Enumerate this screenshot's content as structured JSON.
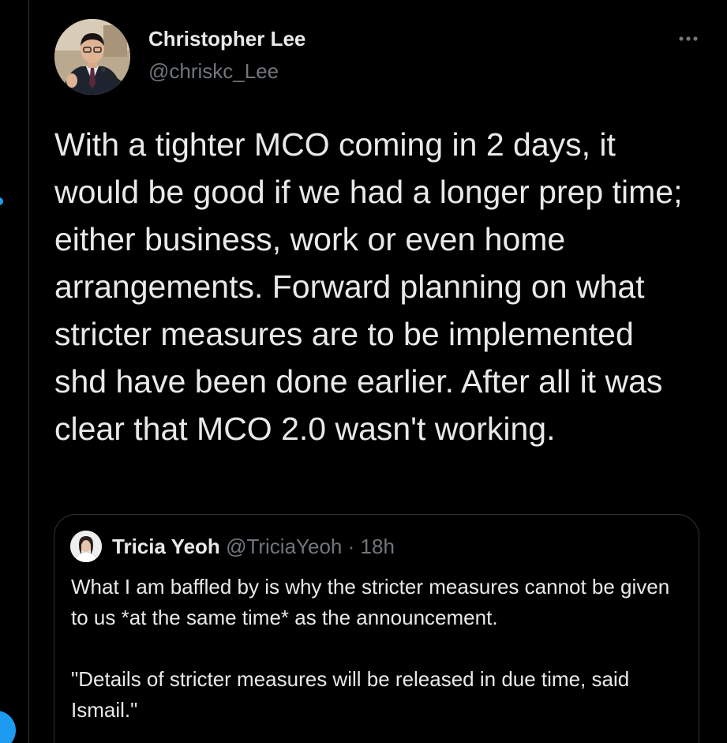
{
  "tweet": {
    "author_name": "Christopher Lee",
    "author_handle": "@chriskc_Lee",
    "more_icon": "more-horizontal-icon",
    "body": "With a tighter MCO coming in 2 days, it would be good if we had a longer prep time; either business, work or even home arrangements. Forward planning on what stricter measures are to be implemented shd have been done earlier. After all it was clear that MCO 2.0 wasn't working."
  },
  "quote": {
    "author_name": "Tricia Yeoh",
    "author_handle": "@TriciaYeoh",
    "separator": "·",
    "time": "18h",
    "paragraph_1": "What I am baffled by is why the stricter measures cannot be given to us *at the same time* as the announcement.",
    "paragraph_2": "\"Details of stricter measures will be released in due time, said Ismail.\""
  },
  "colors": {
    "background": "#000000",
    "text_primary": "#e7e9ea",
    "text_secondary": "#71767b",
    "border": "#2f3336",
    "accent": "#1d9bf0"
  }
}
